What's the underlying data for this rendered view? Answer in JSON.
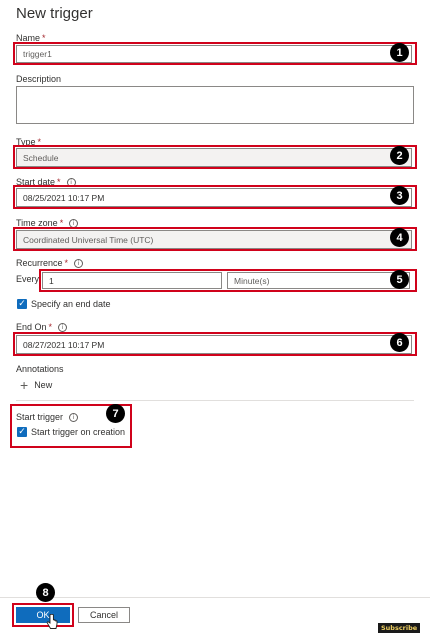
{
  "title": "New trigger",
  "name": {
    "label": "Name",
    "required": "*",
    "value": "trigger1"
  },
  "description": {
    "label": "Description",
    "value": ""
  },
  "type": {
    "label": "Type",
    "required": "*",
    "value": "Schedule"
  },
  "start_date": {
    "label": "Start date",
    "required": "*",
    "value": "08/25/2021 10:17 PM"
  },
  "time_zone": {
    "label": "Time zone",
    "required": "*",
    "value": "Coordinated Universal Time (UTC)"
  },
  "recurrence": {
    "label": "Recurrence",
    "required": "*",
    "every_label": "Every",
    "interval": "1",
    "unit": "Minute(s)"
  },
  "end_date_checkbox": {
    "label": "Specify an end date",
    "checked": true
  },
  "end_on": {
    "label": "End On",
    "required": "*",
    "value": "08/27/2021 10:17 PM"
  },
  "annotations": {
    "label": "Annotations",
    "new_label": "New",
    "plus": "+"
  },
  "start_trigger": {
    "label": "Start trigger",
    "checkbox_label": "Start trigger on creation",
    "checked": true
  },
  "buttons": {
    "ok": "OK",
    "cancel": "Cancel"
  },
  "callouts": [
    "1",
    "2",
    "3",
    "4",
    "5",
    "6",
    "7",
    "8"
  ],
  "watermark": "Subscribe",
  "colors": {
    "accent": "#0f6cbd",
    "highlight": "#d0021b",
    "required": "#a4262c"
  }
}
